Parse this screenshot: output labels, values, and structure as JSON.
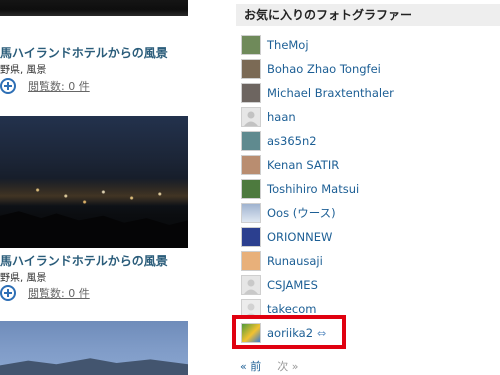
{
  "left": {
    "photos": [
      {
        "title": "馬ハイランドホテルからの風景",
        "location": "野県, 風景",
        "views": "閲覧数: 0 件"
      },
      {
        "title": "馬ハイランドホテルからの風景",
        "location": "野県, 風景",
        "views": "閲覧数: 0 件"
      }
    ]
  },
  "favorites": {
    "title": "お気に入りのフォトグラファー",
    "photographers": [
      {
        "name": "TheMoj",
        "avatar_color": "#6f8a5a"
      },
      {
        "name": "Bohao Zhao Tongfei",
        "avatar_color": "#7b6a55"
      },
      {
        "name": "Michael Braxtenthaler",
        "avatar_color": "#6d6560"
      },
      {
        "name": "haan",
        "avatar_color": "#d8d8d8"
      },
      {
        "name": "as365n2",
        "avatar_color": "#5f8a8f"
      },
      {
        "name": "Kenan SATIR",
        "avatar_color": "#b98d70"
      },
      {
        "name": "Toshihiro Matsui",
        "avatar_color": "#4d7a3e"
      },
      {
        "name": "Oos (ウース)",
        "avatar_color": "#9fb3cf"
      },
      {
        "name": "ORIONNEW",
        "avatar_color": "#2b3f8f"
      },
      {
        "name": "Runausaji",
        "avatar_color": "#e8b07a"
      },
      {
        "name": "CSJAMES",
        "avatar_color": "#dcdcdc"
      },
      {
        "name": "takecom",
        "avatar_color": "#e2e2e2"
      },
      {
        "name": "aoriika2",
        "avatar_color": "#4f9a3a",
        "has_arrow": true
      }
    ]
  },
  "pager": {
    "prev": "« 前",
    "next": "次 »"
  },
  "highlight_color": "#e0000f"
}
